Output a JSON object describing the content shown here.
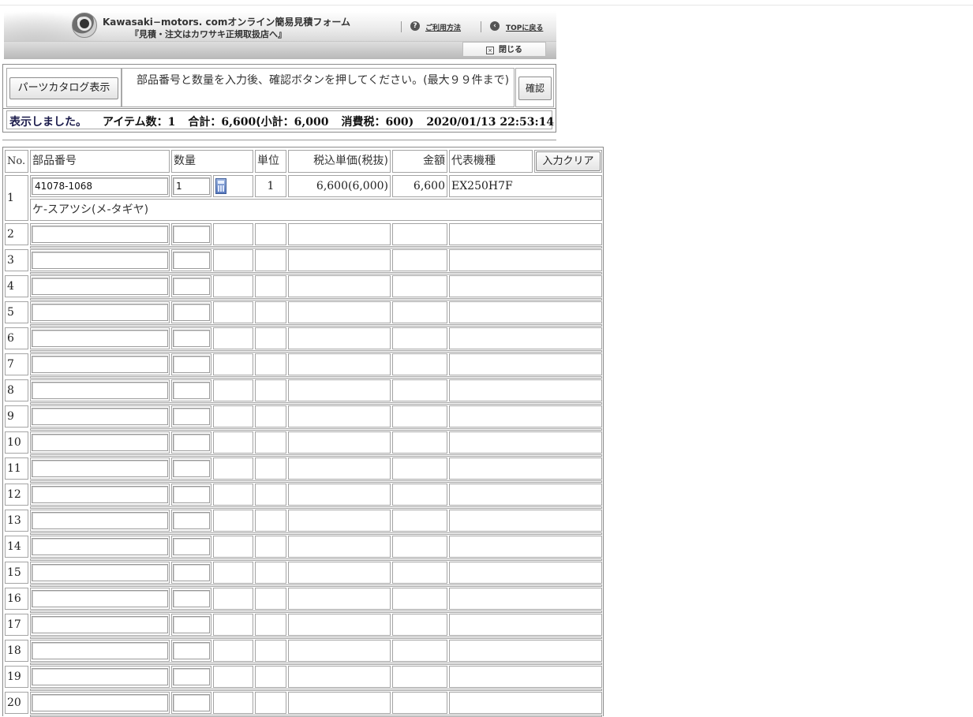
{
  "header": {
    "title_line1": "Kawasaki−motors. comオンライン簡易見積フォーム",
    "title_line2": "『見積・注文はカワサキ正規取扱店へ』",
    "help_link": "ご利用方法",
    "top_link": "TOPに戻る",
    "close_label": "閉じる"
  },
  "instructions": {
    "catalog_button": "パーツカタログ表示",
    "text": "部品番号と数量を入力後、確認ボタンを押してください。(最大９９件まで)",
    "confirm_button": "確認"
  },
  "status": {
    "message": "表示しました。",
    "items_label": "アイテム数：",
    "items_value": "1",
    "total_label": "合計：",
    "total_value": "6,600",
    "subtotal_label": "(小計：",
    "subtotal_value": "6,000",
    "tax_label": "消費税：",
    "tax_value": "600)",
    "timestamp": "2020/01/13 22:53:14"
  },
  "table": {
    "headers": {
      "no": "No.",
      "part_number": "部品番号",
      "quantity": "数量",
      "unit": "単位",
      "unit_price": "税込単価(税抜)",
      "amount": "金額",
      "model": "代表機種",
      "clear_button": "入力クリア"
    },
    "filled_row": {
      "no": "1",
      "part_number": "41078-1068",
      "quantity": "1",
      "unit": "1",
      "unit_price": "6,600(6,000)",
      "amount": "6,600",
      "model": "EX250H7F",
      "description": "ケ-スアツシ(メ-タギヤ)"
    },
    "empty_row_numbers": [
      "2",
      "3",
      "4",
      "5",
      "6",
      "7",
      "8",
      "9",
      "10",
      "11",
      "12",
      "13",
      "14",
      "15",
      "16",
      "17",
      "18",
      "19",
      "20"
    ]
  }
}
